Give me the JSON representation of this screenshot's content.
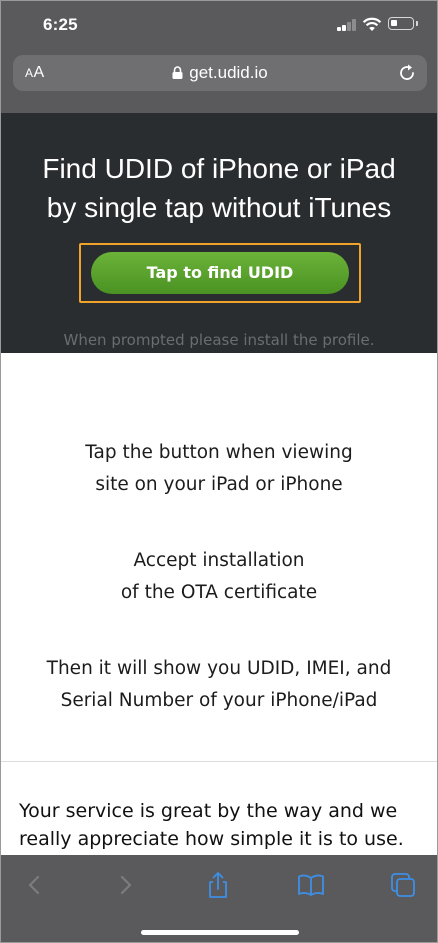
{
  "status_bar": {
    "time": "6:25"
  },
  "address_bar": {
    "aa_small": "A",
    "aa_large": "A",
    "url": "get.udid.io"
  },
  "hero": {
    "title_line1": "Find UDID of iPhone or iPad",
    "title_line2": "by single tap without iTunes",
    "button_label": "Tap to find UDID",
    "note": "When prompted please install the profile."
  },
  "steps": [
    {
      "line1": "Tap the button when viewing",
      "line2": "site on your iPad or iPhone"
    },
    {
      "line1": "Accept installation",
      "line2": "of the OTA certificate"
    },
    {
      "line1": "Then it will show you UDID, IMEI, and",
      "line2": "Serial Number of your iPhone/iPad"
    }
  ],
  "testimonial": "Your service is great by the way and we really appreciate how simple it is to use.",
  "toolbar": {
    "icons": [
      "back-icon",
      "forward-icon",
      "share-icon",
      "bookmarks-icon",
      "tabs-icon"
    ]
  },
  "colors": {
    "chrome": "#5a5a5c",
    "hero_bg": "#2a2d30",
    "button_green": "#5aa32e",
    "highlight_orange": "#f0a32a",
    "safari_blue": "#3d8fe6"
  }
}
